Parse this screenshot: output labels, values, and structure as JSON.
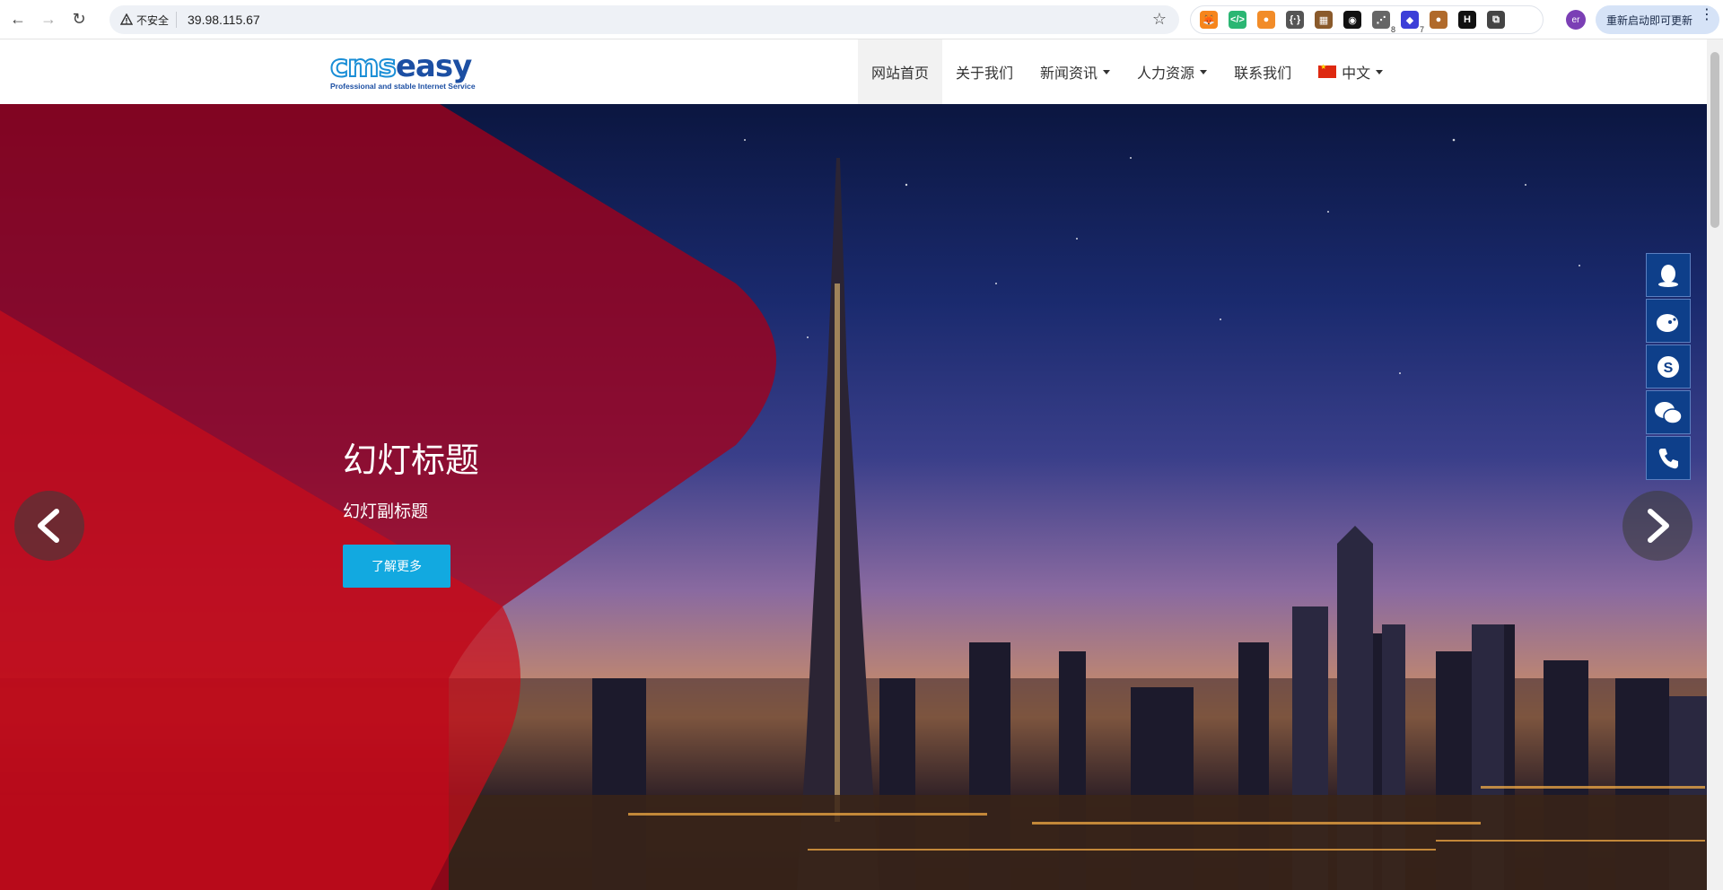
{
  "browser": {
    "security_label": "不安全",
    "url": "39.98.115.67",
    "extensions": [
      {
        "name": "metamask-icon",
        "color": "#f6851b",
        "glyph": "🦊"
      },
      {
        "name": "code-icon",
        "color": "#2bb673",
        "glyph": "</>"
      },
      {
        "name": "orange-circle-icon",
        "color": "#f28c28",
        "glyph": "●"
      },
      {
        "name": "braces-icon",
        "color": "#555555",
        "glyph": "{·}"
      },
      {
        "name": "image-ext-icon",
        "color": "#8a5a2b",
        "glyph": "▦"
      },
      {
        "name": "mask-icon",
        "color": "#111111",
        "glyph": "◉"
      },
      {
        "name": "screenshot-icon",
        "color": "#666666",
        "glyph": "⋰",
        "badge": "8"
      },
      {
        "name": "bookmark-ext-icon",
        "color": "#3c3fd8",
        "glyph": "◆",
        "badge": "7"
      },
      {
        "name": "cookie-icon",
        "color": "#b06a2b",
        "glyph": "●"
      },
      {
        "name": "h-ext-icon",
        "color": "#111111",
        "glyph": "H"
      },
      {
        "name": "puzzle-icon",
        "color": "#444444",
        "glyph": "⧉"
      }
    ],
    "profile_initials": "er",
    "update_label": "重新启动即可更新"
  },
  "site": {
    "logo_tagline": "Professional and stable Internet Service",
    "nav": [
      {
        "label": "网站首页",
        "active": true,
        "dropdown": false
      },
      {
        "label": "关于我们",
        "active": false,
        "dropdown": false
      },
      {
        "label": "新闻资讯",
        "active": false,
        "dropdown": true
      },
      {
        "label": "人力资源",
        "active": false,
        "dropdown": true
      },
      {
        "label": "联系我们",
        "active": false,
        "dropdown": false
      },
      {
        "label": "中文",
        "active": false,
        "dropdown": true,
        "flag": true
      }
    ]
  },
  "slider": {
    "title": "幻灯标题",
    "subtitle": "幻灯副标题",
    "button_label": "了解更多"
  },
  "side_tools": [
    "qq-icon",
    "weibo-icon",
    "skype-icon",
    "wechat-icon",
    "phone-icon"
  ],
  "colors": {
    "accent": "#12a9e0",
    "side_tool_bg": "#0e3f8a",
    "overlay_red": "#c0101e"
  }
}
